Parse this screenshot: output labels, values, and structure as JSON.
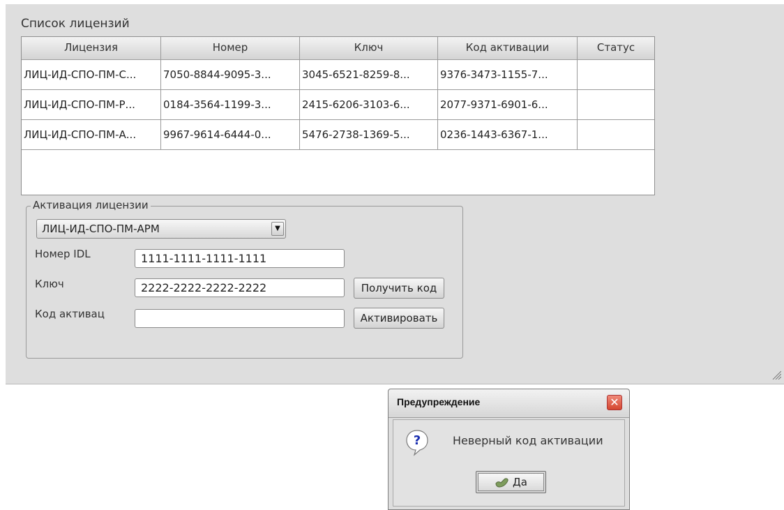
{
  "licenses": {
    "title": "Список лицензий",
    "columns": [
      "Лицензия",
      "Номер",
      "Ключ",
      "Код активации",
      "Статус"
    ],
    "rows": [
      [
        "ЛИЦ-ИД-СПО-ПМ-С...",
        "7050-8844-9095-3...",
        "3045-6521-8259-8...",
        "9376-3473-1155-7...",
        ""
      ],
      [
        "ЛИЦ-ИД-СПО-ПМ-Р...",
        "0184-3564-1199-3...",
        "2415-6206-3103-6...",
        "2077-9371-6901-6...",
        ""
      ],
      [
        "ЛИЦ-ИД-СПО-ПМ-А...",
        "9967-9614-6444-0...",
        "5476-2738-1369-5...",
        "0236-1443-6367-1...",
        ""
      ]
    ]
  },
  "activation": {
    "legend": "Активация лицензии",
    "selected_license": "ЛИЦ-ИД-СПО-ПМ-АРМ",
    "idl_label": "Номер IDL",
    "idl_value": "1111-1111-1111-1111",
    "key_label": "Ключ",
    "key_value": "2222-2222-2222-2222",
    "code_label": "Код активац",
    "code_value": "",
    "get_code_button": "Получить код",
    "activate_button": "Активировать"
  },
  "dialog": {
    "title": "Предупреждение",
    "message": "Неверный код активации",
    "ok_button": "Да"
  }
}
